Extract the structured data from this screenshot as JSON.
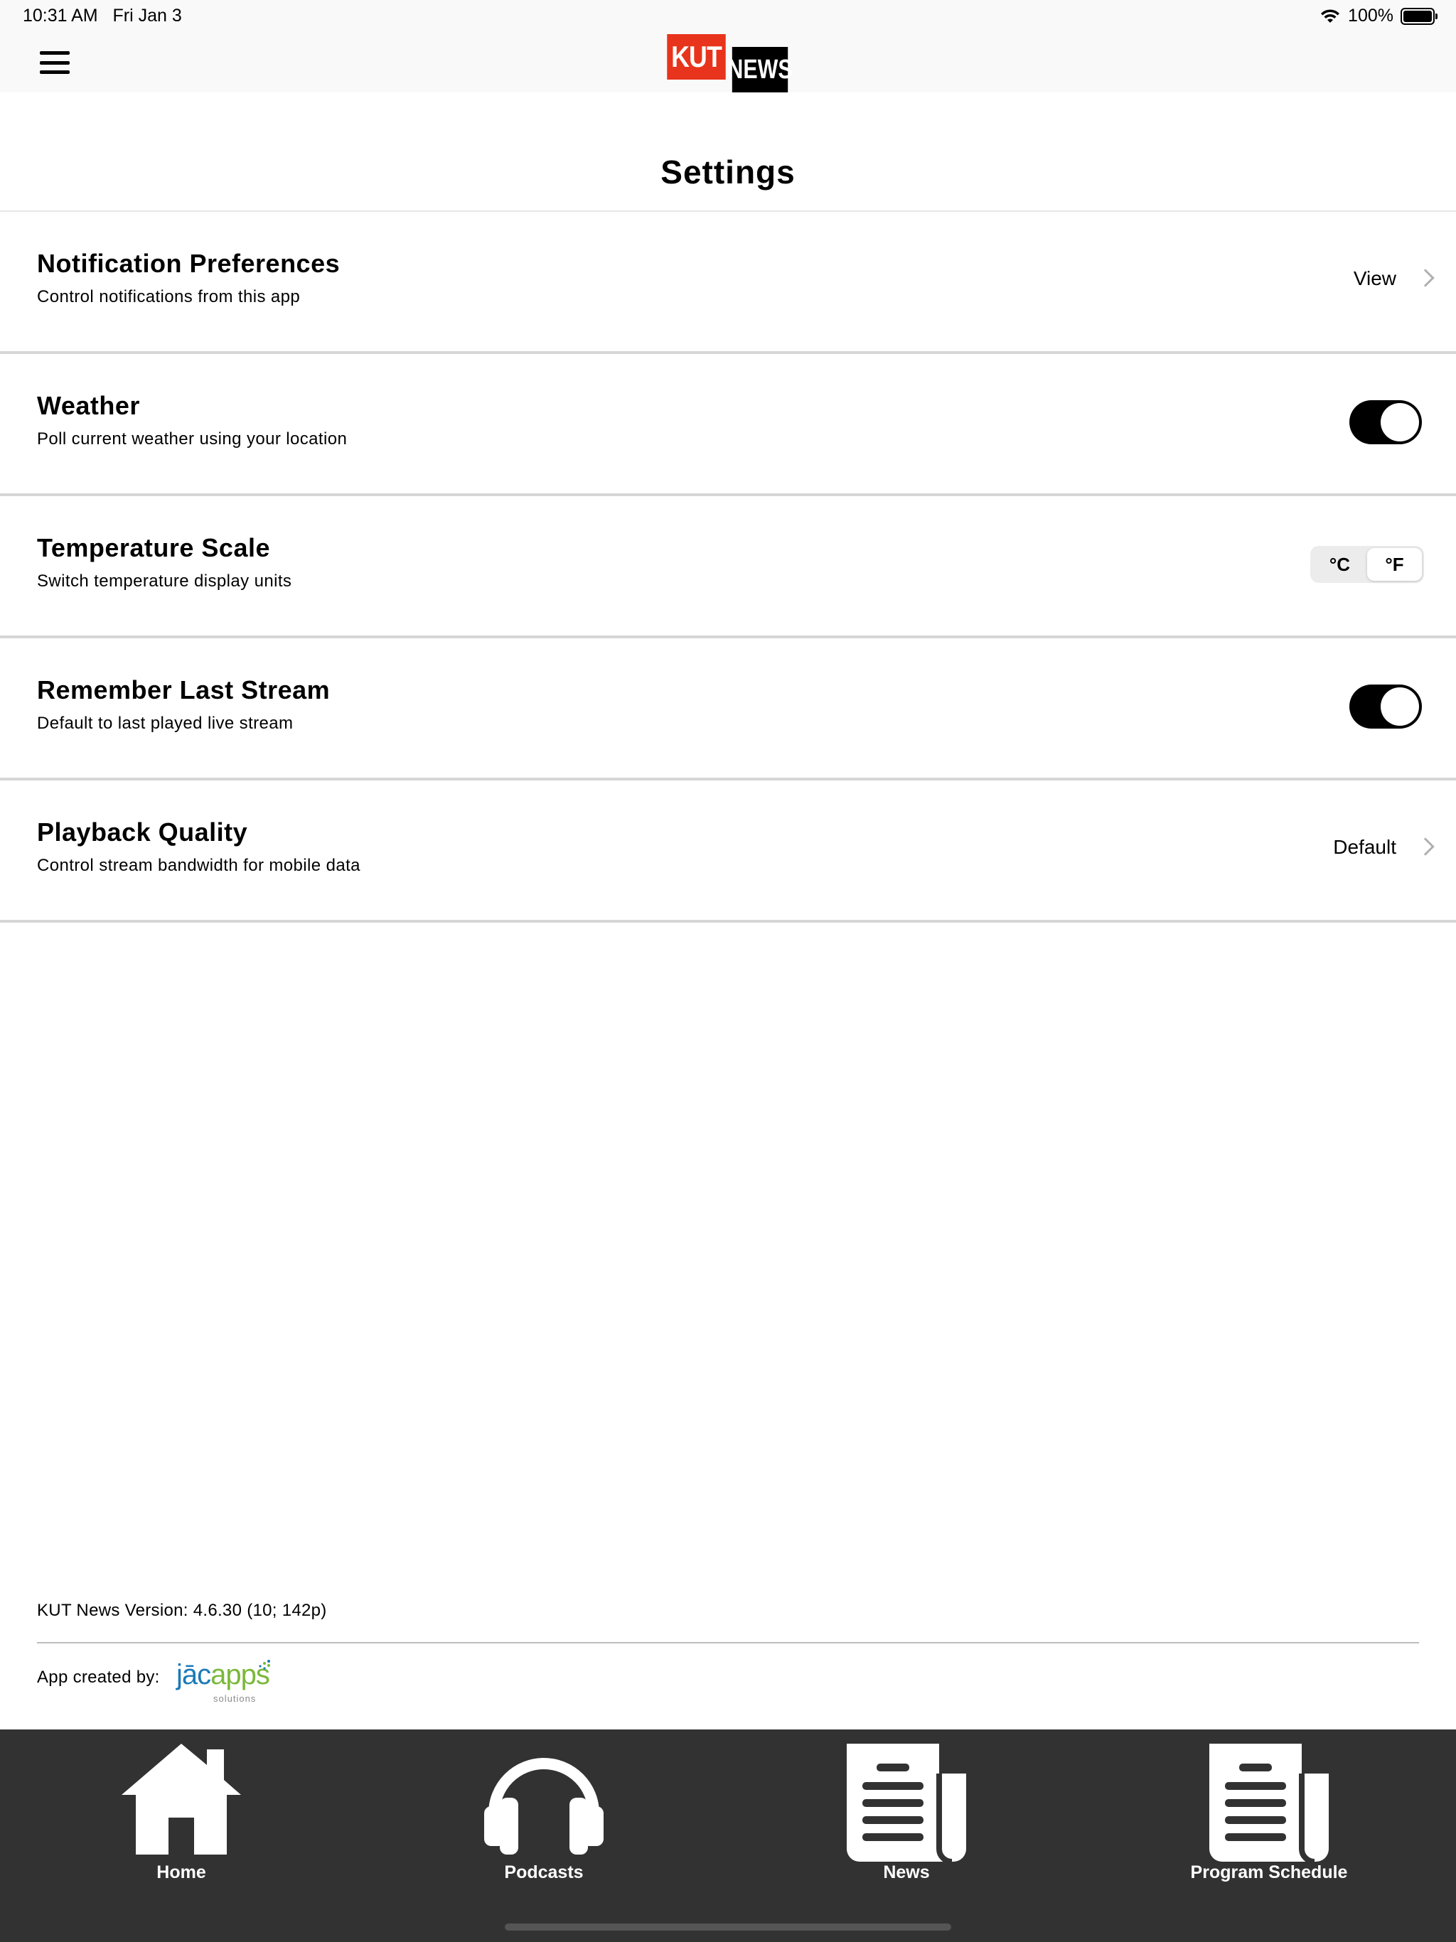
{
  "status_bar": {
    "time": "10:31 AM",
    "date": "Fri Jan 3",
    "battery": "100%",
    "battery_level": 1.0
  },
  "nav": {
    "logo_left": "KUT",
    "logo_right": "NEWS",
    "logo_colors": {
      "left_bg": "#e8341c",
      "right_bg": "#000000"
    }
  },
  "page": {
    "title": "Settings"
  },
  "settings": [
    {
      "title": "Notification Preferences",
      "subtitle": "Control notifications from this app",
      "control": "link",
      "value": "View"
    },
    {
      "title": "Weather",
      "subtitle": "Poll current weather using your location",
      "control": "toggle",
      "on": true
    },
    {
      "title": "Temperature Scale",
      "subtitle": "Switch temperature display units",
      "control": "segmented",
      "options": [
        "°C",
        "°F"
      ],
      "selected": "°F"
    },
    {
      "title": "Remember Last Stream",
      "subtitle": "Default to last played live stream",
      "control": "toggle",
      "on": true
    },
    {
      "title": "Playback Quality",
      "subtitle": "Control stream bandwidth for mobile data",
      "control": "link",
      "value": "Default"
    }
  ],
  "footer": {
    "version": "KUT News Version: 4.6.30 (10; 142p)",
    "created_by": "App created by:",
    "vendor_logo_main_a": "jāc",
    "vendor_logo_main_b": "apps",
    "vendor_logo_sub": "solutions"
  },
  "tabs": [
    {
      "label": "Home",
      "icon": "home-icon"
    },
    {
      "label": "Podcasts",
      "icon": "headphones-icon"
    },
    {
      "label": "News",
      "icon": "newspaper-icon"
    },
    {
      "label": "Program Schedule",
      "icon": "newspaper-icon"
    }
  ],
  "colors": {
    "tab_bar_bg": "#323232",
    "row_divider": "#d6d6d6",
    "toggle_on": "#000000"
  }
}
